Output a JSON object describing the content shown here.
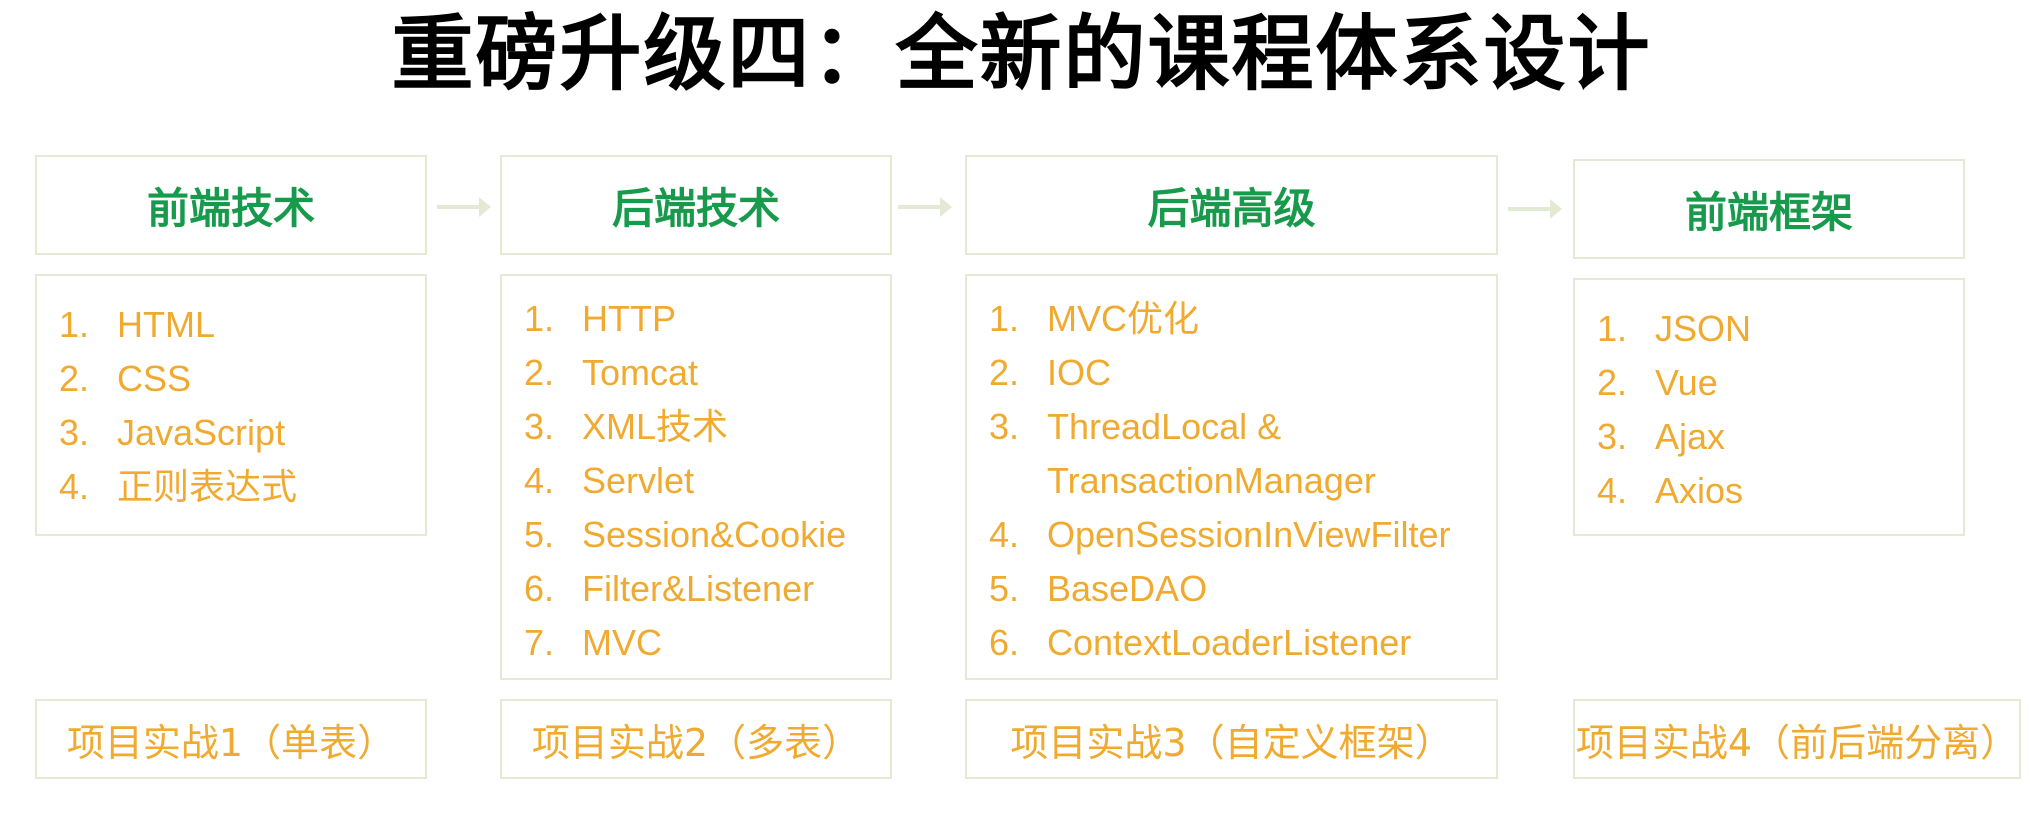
{
  "title": "重磅升级四：全新的课程体系设计",
  "columns": [
    {
      "heading": "前端技术",
      "items": [
        {
          "num": "1.",
          "text": "HTML"
        },
        {
          "num": "2.",
          "text": "CSS"
        },
        {
          "num": "3.",
          "text": "JavaScript"
        },
        {
          "num": "4.",
          "text": "正则表达式"
        }
      ],
      "project": "项目实战1（单表）"
    },
    {
      "heading": "后端技术",
      "items": [
        {
          "num": "1.",
          "text": "HTTP"
        },
        {
          "num": "2.",
          "text": "Tomcat"
        },
        {
          "num": "3.",
          "text": "XML技术"
        },
        {
          "num": "4.",
          "text": "Servlet"
        },
        {
          "num": "5.",
          "text": "Session&Cookie"
        },
        {
          "num": "6.",
          "text": "Filter&Listener"
        },
        {
          "num": "7.",
          "text": "MVC"
        }
      ],
      "project": "项目实战2（多表）"
    },
    {
      "heading": "后端高级",
      "items": [
        {
          "num": "1.",
          "text": "MVC优化"
        },
        {
          "num": "2.",
          "text": "IOC"
        },
        {
          "num": "3.",
          "text": "ThreadLocal &"
        },
        {
          "num": "",
          "text": "TransactionManager"
        },
        {
          "num": "4.",
          "text": "OpenSessionInViewFilter"
        },
        {
          "num": "5.",
          "text": "BaseDAO"
        },
        {
          "num": "6.",
          "text": "ContextLoaderListener"
        }
      ],
      "project": "项目实战3（自定义框架）"
    },
    {
      "heading": "前端框架",
      "items": [
        {
          "num": "1.",
          "text": "JSON"
        },
        {
          "num": "2.",
          "text": "Vue"
        },
        {
          "num": "3.",
          "text": "Ajax"
        },
        {
          "num": "4.",
          "text": "Axios"
        }
      ],
      "project": "项目实战4（前后端分离）"
    }
  ],
  "colors": {
    "heading": "#179a4c",
    "item_text": "#efaa2f",
    "border": "#e3ead3",
    "title": "#000000"
  }
}
